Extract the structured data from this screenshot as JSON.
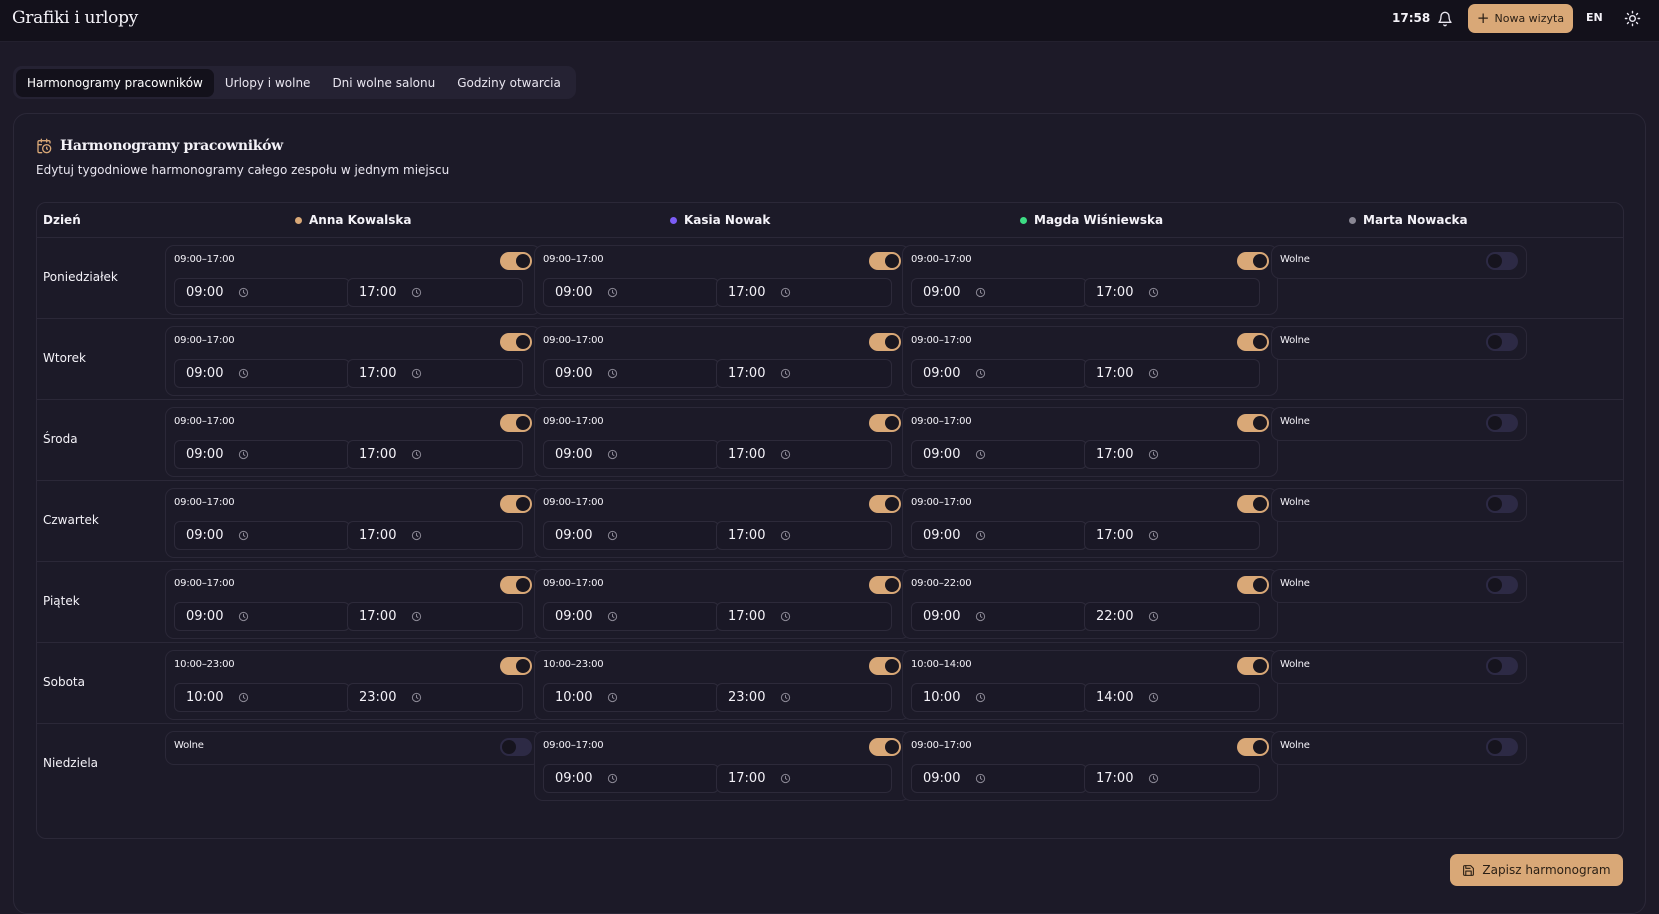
{
  "app": {
    "title": "Grafiki i urlopy",
    "clock": "17:58",
    "new_visit_label": "Nowa wizyta",
    "lang": "EN"
  },
  "tabs": [
    {
      "label": "Harmonogramy pracowników",
      "active": true
    },
    {
      "label": "Urlopy i wolne",
      "active": false
    },
    {
      "label": "Dni wolne salonu",
      "active": false
    },
    {
      "label": "Godziny otwarcia",
      "active": false
    }
  ],
  "panel": {
    "title": "Harmonogramy pracowników",
    "subtitle": "Edytuj tygodniowe harmonogramy całego zespołu w jednym miejscu",
    "day_header": "Dzień",
    "save_label": "Zapisz harmonogram"
  },
  "employees": [
    {
      "name": "Anna Kowalska",
      "color": "#d9a877"
    },
    {
      "name": "Kasia Nowak",
      "color": "#7c5cf6"
    },
    {
      "name": "Magda Wiśniewska",
      "color": "#3ddc84"
    },
    {
      "name": "Marta Nowacka",
      "color": "#8a8794"
    }
  ],
  "off_label": "Wolne",
  "days": [
    {
      "name": "Poniedziałek",
      "shifts": [
        {
          "on": true,
          "label": "09:00–17:00",
          "start": "09:00",
          "end": "17:00"
        },
        {
          "on": true,
          "label": "09:00–17:00",
          "start": "09:00",
          "end": "17:00"
        },
        {
          "on": true,
          "label": "09:00–17:00",
          "start": "09:00",
          "end": "17:00"
        },
        {
          "on": false,
          "label": "Wolne"
        }
      ]
    },
    {
      "name": "Wtorek",
      "shifts": [
        {
          "on": true,
          "label": "09:00–17:00",
          "start": "09:00",
          "end": "17:00"
        },
        {
          "on": true,
          "label": "09:00–17:00",
          "start": "09:00",
          "end": "17:00"
        },
        {
          "on": true,
          "label": "09:00–17:00",
          "start": "09:00",
          "end": "17:00"
        },
        {
          "on": false,
          "label": "Wolne"
        }
      ]
    },
    {
      "name": "Środa",
      "shifts": [
        {
          "on": true,
          "label": "09:00–17:00",
          "start": "09:00",
          "end": "17:00"
        },
        {
          "on": true,
          "label": "09:00–17:00",
          "start": "09:00",
          "end": "17:00"
        },
        {
          "on": true,
          "label": "09:00–17:00",
          "start": "09:00",
          "end": "17:00"
        },
        {
          "on": false,
          "label": "Wolne"
        }
      ]
    },
    {
      "name": "Czwartek",
      "shifts": [
        {
          "on": true,
          "label": "09:00–17:00",
          "start": "09:00",
          "end": "17:00"
        },
        {
          "on": true,
          "label": "09:00–17:00",
          "start": "09:00",
          "end": "17:00"
        },
        {
          "on": true,
          "label": "09:00–17:00",
          "start": "09:00",
          "end": "17:00"
        },
        {
          "on": false,
          "label": "Wolne"
        }
      ]
    },
    {
      "name": "Piątek",
      "shifts": [
        {
          "on": true,
          "label": "09:00–17:00",
          "start": "09:00",
          "end": "17:00"
        },
        {
          "on": true,
          "label": "09:00–17:00",
          "start": "09:00",
          "end": "17:00"
        },
        {
          "on": true,
          "label": "09:00–22:00",
          "start": "09:00",
          "end": "22:00"
        },
        {
          "on": false,
          "label": "Wolne"
        }
      ]
    },
    {
      "name": "Sobota",
      "shifts": [
        {
          "on": true,
          "label": "10:00–23:00",
          "start": "10:00",
          "end": "23:00"
        },
        {
          "on": true,
          "label": "10:00–23:00",
          "start": "10:00",
          "end": "23:00"
        },
        {
          "on": true,
          "label": "10:00–14:00",
          "start": "10:00",
          "end": "14:00"
        },
        {
          "on": false,
          "label": "Wolne"
        }
      ]
    },
    {
      "name": "Niedziela",
      "shifts": [
        {
          "on": false,
          "label": "Wolne"
        },
        {
          "on": true,
          "label": "09:00–17:00",
          "start": "09:00",
          "end": "17:00"
        },
        {
          "on": true,
          "label": "09:00–17:00",
          "start": "09:00",
          "end": "17:00"
        },
        {
          "on": false,
          "label": "Wolne"
        }
      ]
    }
  ]
}
